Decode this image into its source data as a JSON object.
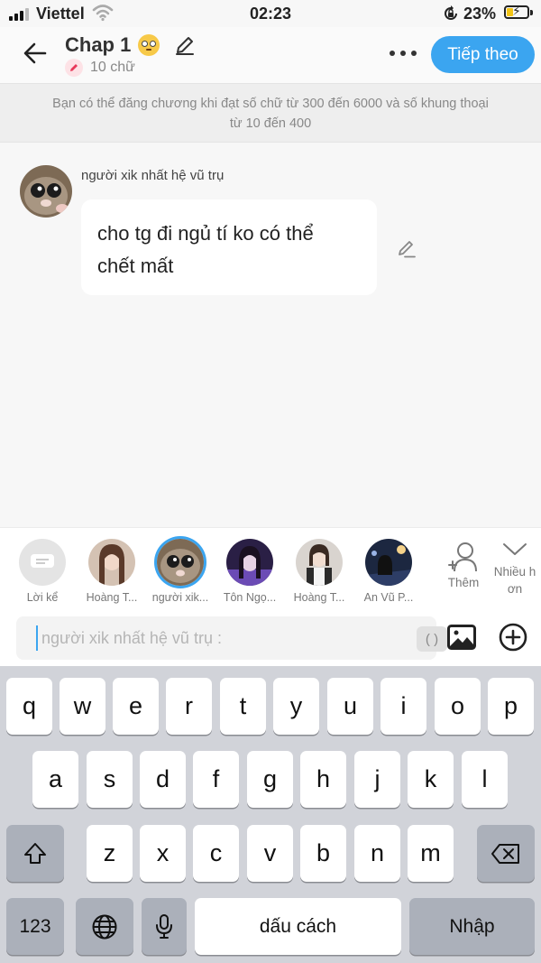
{
  "status_bar": {
    "carrier": "Viettel",
    "time": "02:23",
    "battery_percent": "23%",
    "battery_level": 0.23,
    "icons": [
      "signal-icon",
      "wifi-icon",
      "rotation-lock-icon",
      "battery-charging-icon"
    ]
  },
  "header": {
    "title": "Chap 1",
    "title_emoji": "flushed-face-emoji",
    "word_count": "10 chữ",
    "next_label": "Tiếp theo",
    "icons": [
      "back-arrow-icon",
      "pencil-icon",
      "more-icon"
    ]
  },
  "notice": {
    "line1": "Bạn có thể đăng chương khi đạt số chữ từ 300 đến 6000 và số khung thoại",
    "line2": "từ 10 đến 400"
  },
  "message": {
    "author": "người xik nhất hệ vũ trụ",
    "text_line1": "cho tg đi ngủ tí ko có thể",
    "text_line2": "chết mất"
  },
  "characters": [
    {
      "label": "Lời kể",
      "selected": false
    },
    {
      "label": "Hoàng T...",
      "selected": false
    },
    {
      "label": "người xik...",
      "selected": true
    },
    {
      "label": "Tôn Ngọ...",
      "selected": false
    },
    {
      "label": "Hoàng T...",
      "selected": false
    },
    {
      "label": "An Vũ P...",
      "selected": false
    }
  ],
  "add_character_label": "Thêm",
  "collapse_label_1": "Nhiều h",
  "collapse_label_2": "ơn",
  "input": {
    "placeholder": "người xik nhất hệ vũ trụ :",
    "value": "",
    "paren_label": "( )"
  },
  "keyboard": {
    "row1": [
      "q",
      "w",
      "e",
      "r",
      "t",
      "y",
      "u",
      "i",
      "o",
      "p"
    ],
    "row2": [
      "a",
      "s",
      "d",
      "f",
      "g",
      "h",
      "j",
      "k",
      "l"
    ],
    "row3": [
      "z",
      "x",
      "c",
      "v",
      "b",
      "n",
      "m"
    ],
    "numbers_label": "123",
    "space_label": "dấu cách",
    "return_label": "Nhập"
  },
  "colors": {
    "accent": "#3ba5f0",
    "background": "#f7f7f7",
    "keyboard_bg": "#d1d3d9"
  }
}
